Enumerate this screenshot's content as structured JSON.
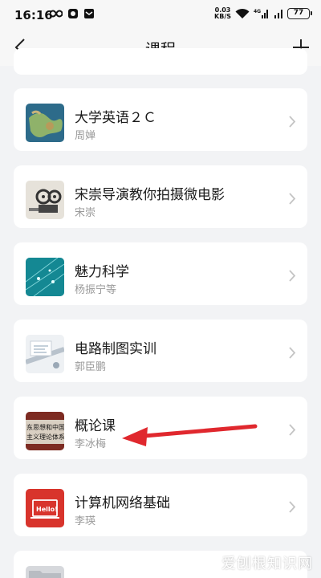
{
  "status_bar": {
    "time": "16:16",
    "net_speed_value": "0.03",
    "net_speed_unit": "KB/S",
    "battery": "77"
  },
  "nav": {
    "title": "课程"
  },
  "courses": [
    {
      "title": "大学英语２Ｃ",
      "teacher": "周婵"
    },
    {
      "title": "宋崇导演教你拍摄微电影",
      "teacher": "宋崇"
    },
    {
      "title": "魅力科学",
      "teacher": "杨振宁等"
    },
    {
      "title": "电路制图实训",
      "teacher": "郭臣鹏"
    },
    {
      "title": "概论课",
      "teacher": "李冰梅",
      "thumb_text_1": "东思想和中国",
      "thumb_text_2": "主义理论体系"
    },
    {
      "title": "计算机网络基础",
      "teacher": "李瑛",
      "thumb_text": "Hello!"
    },
    {
      "title": ""
    }
  ],
  "watermark": "爱刨根知识网",
  "colors": {
    "background": "#f2f3f5",
    "card": "#ffffff",
    "annotation_arrow": "#e0282e"
  }
}
